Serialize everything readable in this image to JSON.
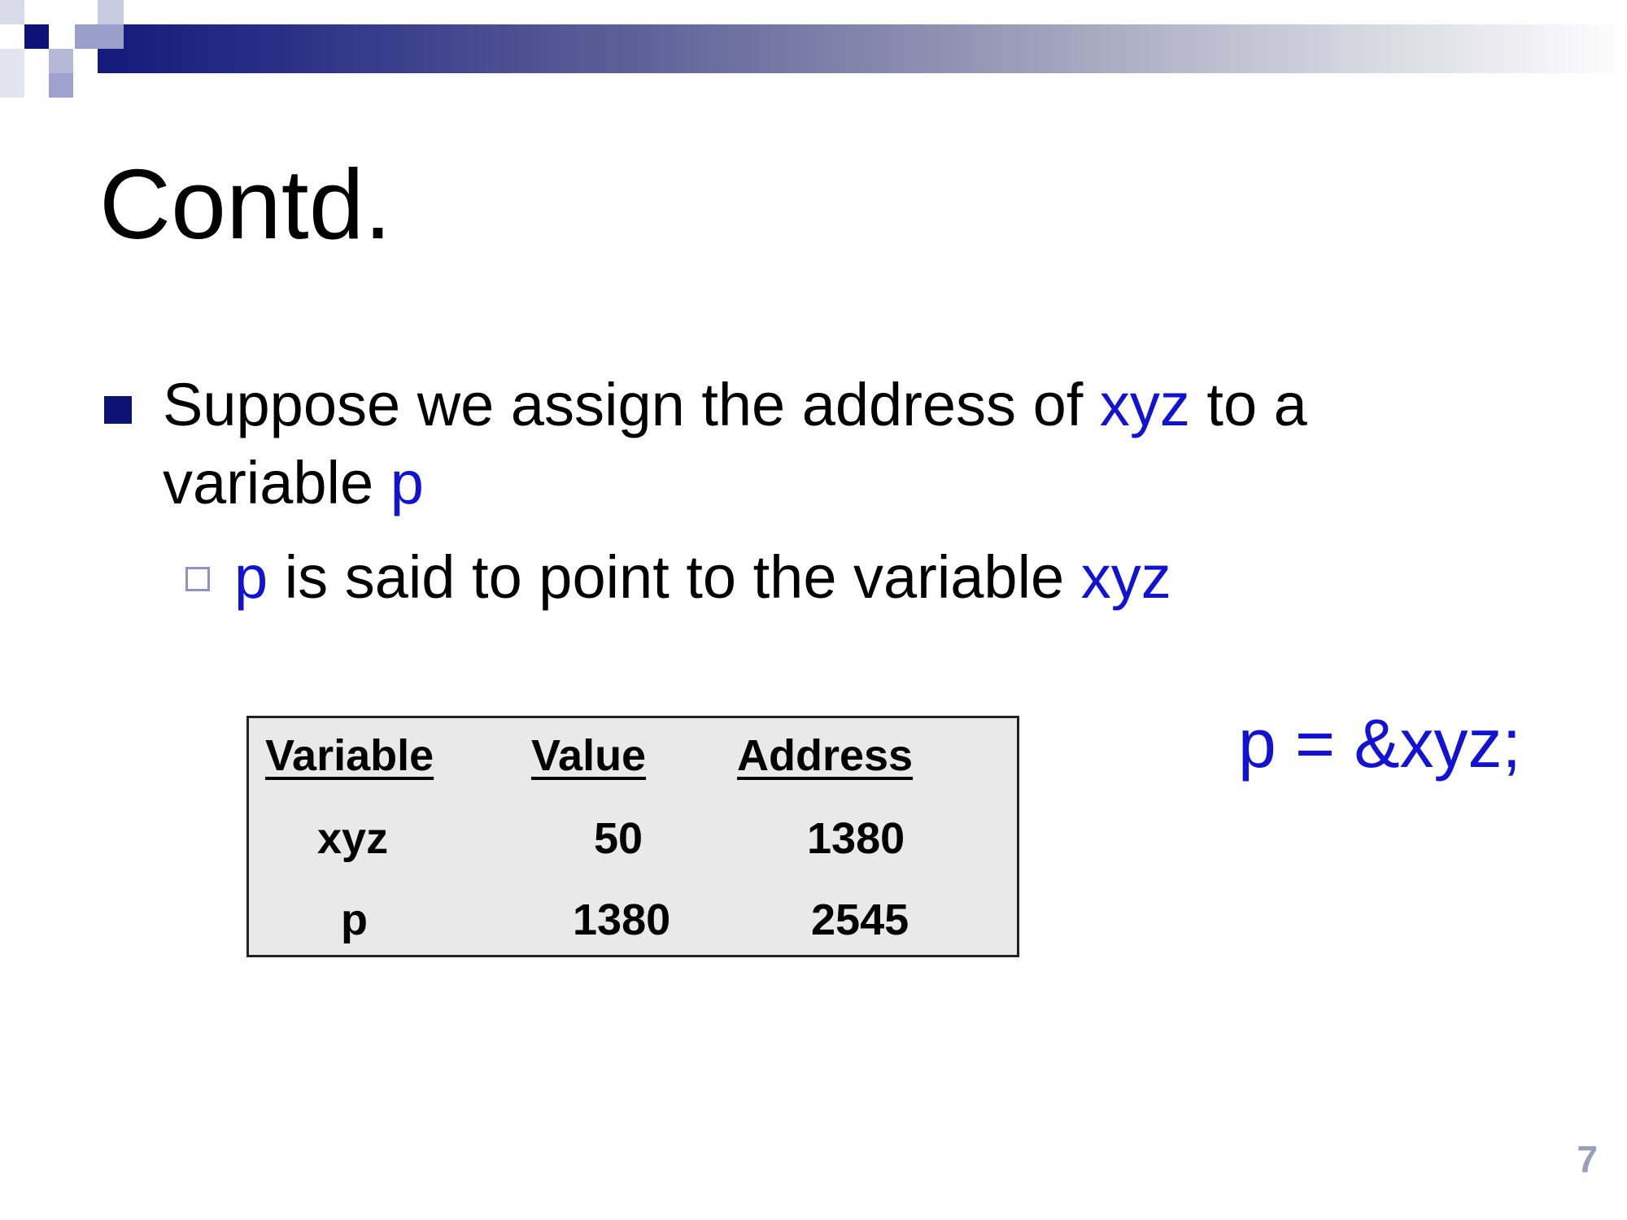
{
  "slide": {
    "title": "Contd.",
    "bullet1": {
      "text_a": "Suppose we assign the address of ",
      "code_a": "xyz",
      "text_b": " to a variable ",
      "code_b": "p"
    },
    "bullet2": {
      "code_a": "p",
      "text_a": " is said to point to the variable ",
      "code_b": "xyz"
    },
    "table": {
      "headers": [
        "Variable",
        "Value",
        "Address"
      ],
      "rows": [
        [
          "xyz",
          "50",
          "1380"
        ],
        [
          "p",
          "1380",
          "2545"
        ]
      ]
    },
    "expression": "p = &xyz;",
    "page_number": "7"
  },
  "colors": {
    "code_blue": "#1212d2",
    "bullet_navy": "#0d1174",
    "table_bg": "#e9e9e9",
    "page_number": "#9a9db8"
  },
  "icons": {
    "bullet1": "filled-square-bullet",
    "bullet2": "hollow-square-bullet"
  }
}
